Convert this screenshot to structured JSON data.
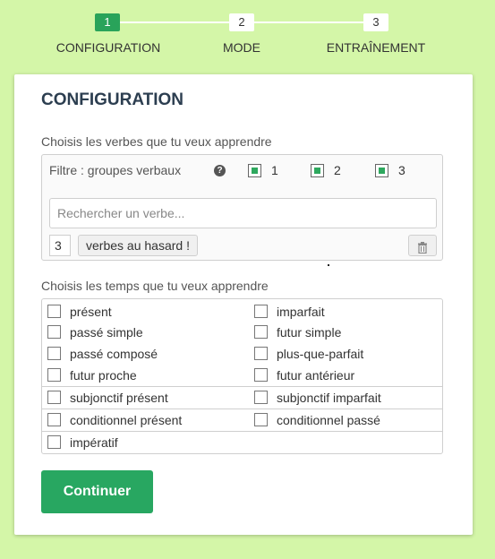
{
  "stepper": {
    "steps": [
      {
        "number": "1",
        "label": "CONFIGURATION",
        "active": true
      },
      {
        "number": "2",
        "label": "MODE",
        "active": false
      },
      {
        "number": "3",
        "label": "ENTRAÎNEMENT",
        "active": false
      }
    ]
  },
  "card": {
    "title": "CONFIGURATION",
    "verbs_section_label": "Choisis les verbes que tu veux apprendre",
    "filter": {
      "label": "Filtre : groupes verbaux",
      "help_icon": "help-circle-icon",
      "groups": [
        {
          "label": "1",
          "checked": true
        },
        {
          "label": "2",
          "checked": true
        },
        {
          "label": "3",
          "checked": true
        }
      ]
    },
    "search": {
      "placeholder": "Rechercher un verbe...",
      "value": ""
    },
    "random": {
      "count": "3",
      "button_label": "verbes au hasard !",
      "trash_icon": "trash-icon"
    },
    "tenses_section_label": "Choisis les temps que tu veux apprendre",
    "tense_groups": [
      [
        {
          "label": "présent",
          "checked": false
        },
        {
          "label": "imparfait",
          "checked": false
        },
        {
          "label": "passé simple",
          "checked": false
        },
        {
          "label": "futur simple",
          "checked": false
        },
        {
          "label": "passé composé",
          "checked": false
        },
        {
          "label": "plus-que-parfait",
          "checked": false
        },
        {
          "label": "futur proche",
          "checked": false
        },
        {
          "label": "futur antérieur",
          "checked": false
        }
      ],
      [
        {
          "label": "subjonctif présent",
          "checked": false
        },
        {
          "label": "subjonctif imparfait",
          "checked": false
        }
      ],
      [
        {
          "label": "conditionnel présent",
          "checked": false
        },
        {
          "label": "conditionnel passé",
          "checked": false
        }
      ],
      [
        {
          "label": "impératif",
          "checked": false
        }
      ]
    ],
    "continue_label": "Continuer"
  },
  "colors": {
    "background": "#d4f6a8",
    "accent": "#28a761",
    "title": "#2c3e50"
  }
}
